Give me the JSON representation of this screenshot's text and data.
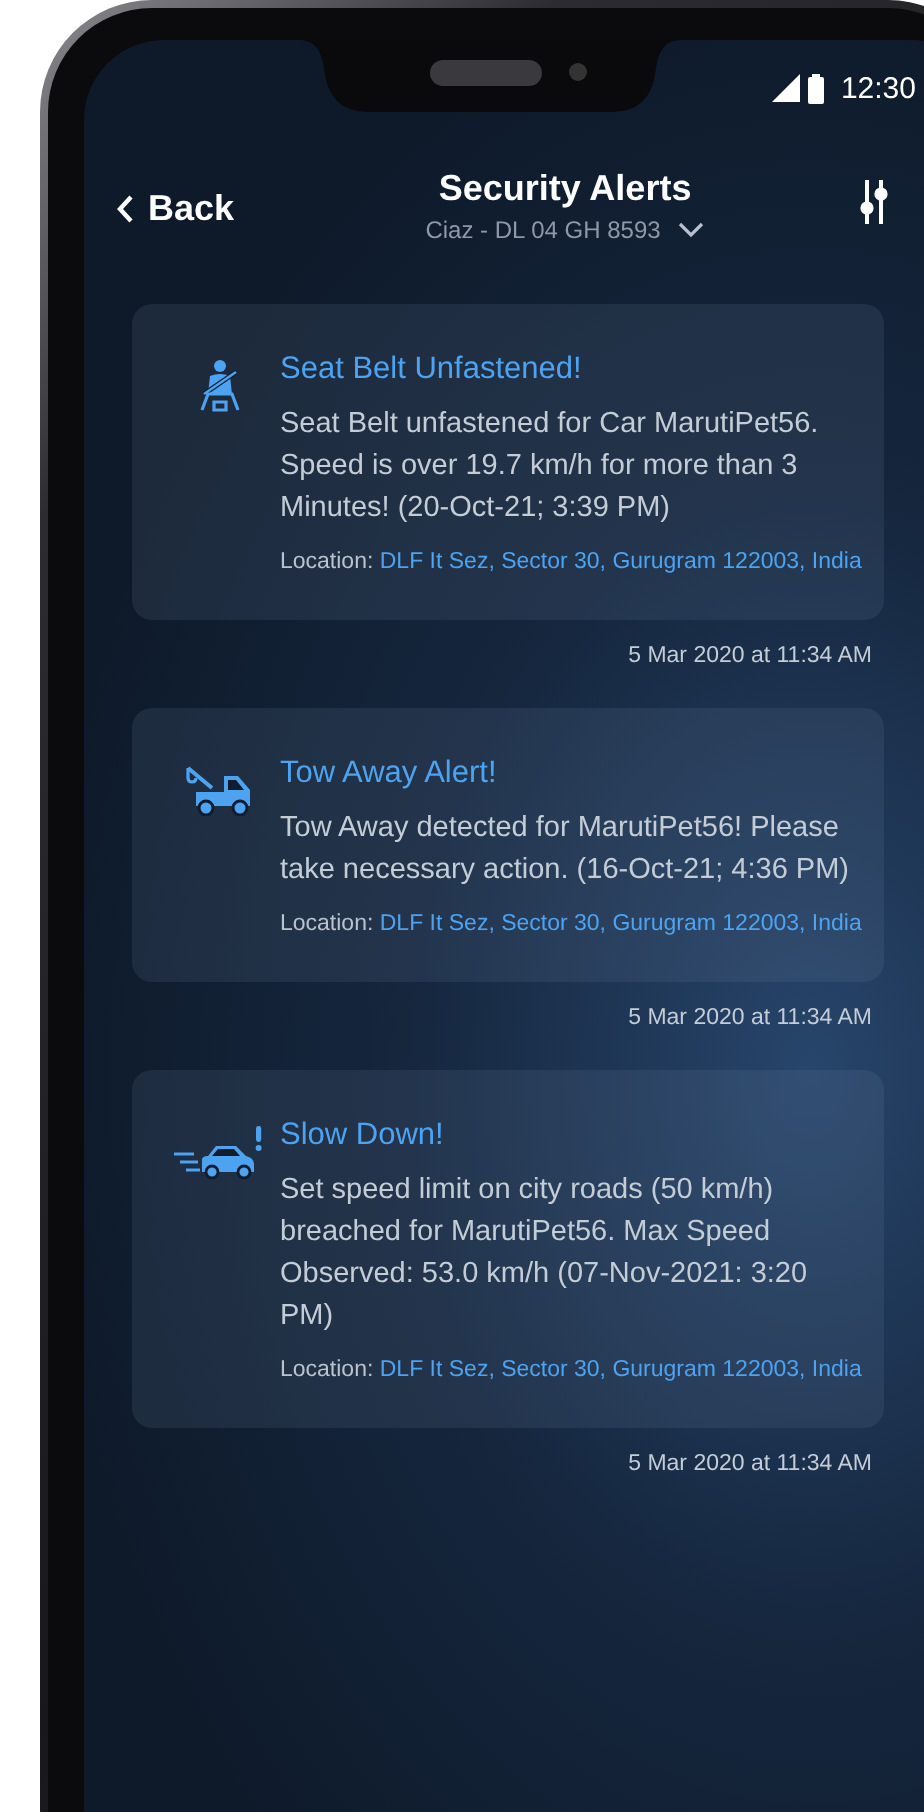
{
  "status_bar": {
    "time": "12:30"
  },
  "header": {
    "back": "Back",
    "title": "Security Alerts",
    "vehicle": "Ciaz - DL 04 GH 8593"
  },
  "alerts": [
    {
      "kind": "seatbelt",
      "title": "Seat Belt Unfastened!",
      "message": "Seat Belt unfastened for Car MarutiPet56. Speed is over 19.7 km/h for more than 3 Minutes! (20-Oct-21; 3:39 PM)",
      "location_label": "Location:",
      "location": "DLF It Sez, Sector 30, Gurugram 122003, India",
      "timestamp": "5 Mar 2020 at 11:34 AM"
    },
    {
      "kind": "tow",
      "title": "Tow Away Alert!",
      "message": "Tow Away detected for MarutiPet56! Please take necessary action. (16-Oct-21; 4:36 PM)",
      "location_label": "Location:",
      "location": "DLF It Sez, Sector 30, Gurugram 122003, India",
      "timestamp": "5 Mar 2020 at 11:34 AM"
    },
    {
      "kind": "speed",
      "title": "Slow Down!",
      "message": "Set speed limit on city roads (50 km/h) breached for MarutiPet56. Max Speed Observed: 53.0 km/h (07-Nov-2021: 3:20 PM)",
      "location_label": "Location:",
      "location": "DLF It Sez, Sector 30, Gurugram 122003, India",
      "timestamp": "5 Mar 2020 at 11:34 AM"
    }
  ]
}
